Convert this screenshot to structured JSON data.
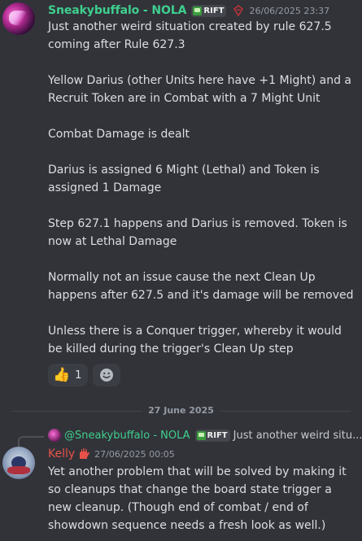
{
  "message1": {
    "author": "Sneakybuffalo - NOLA",
    "tag": "RIFT",
    "timestamp": "26/06/2025 23:37",
    "text": "Just another weird situation created by rule 627.5 coming after Rule 627.3\n\nYellow Darius (other Units here have +1 Might) and a Recruit Token are in Combat with a 7 Might Unit\n\nCombat Damage is dealt\n\nDarius is assigned 6 Might (Lethal) and Token is assigned 1 Damage\n\nStep 627.1 happens and Darius is removed. Token is now at Lethal Damage\n\nNormally not an issue cause the next Clean Up happens after 627.5 and it's damage will be removed\n\nUnless there is a Conquer trigger, whereby it would be killed during the trigger's Clean Up step",
    "reactions": [
      {
        "emoji": "👍",
        "count": "1"
      }
    ]
  },
  "date_divider": "27 June 2025",
  "message2": {
    "reply": {
      "author": "@Sneakybuffalo - NOLA",
      "tag": "RIFT",
      "snippet": "Just another weird situ..."
    },
    "author": "Kelly",
    "timestamp": "27/06/2025 00:05",
    "text": "Yet another problem that will be solved by making it so cleanups that change the board state trigger a new cleanup. (Though end of combat / end of showdown sequence needs a fresh look as well.)"
  },
  "colors": {
    "background": "#323339",
    "username_green": "#3ecf8e",
    "username_red": "#e8524a",
    "text": "#dbdee1",
    "muted": "#949ba4"
  }
}
